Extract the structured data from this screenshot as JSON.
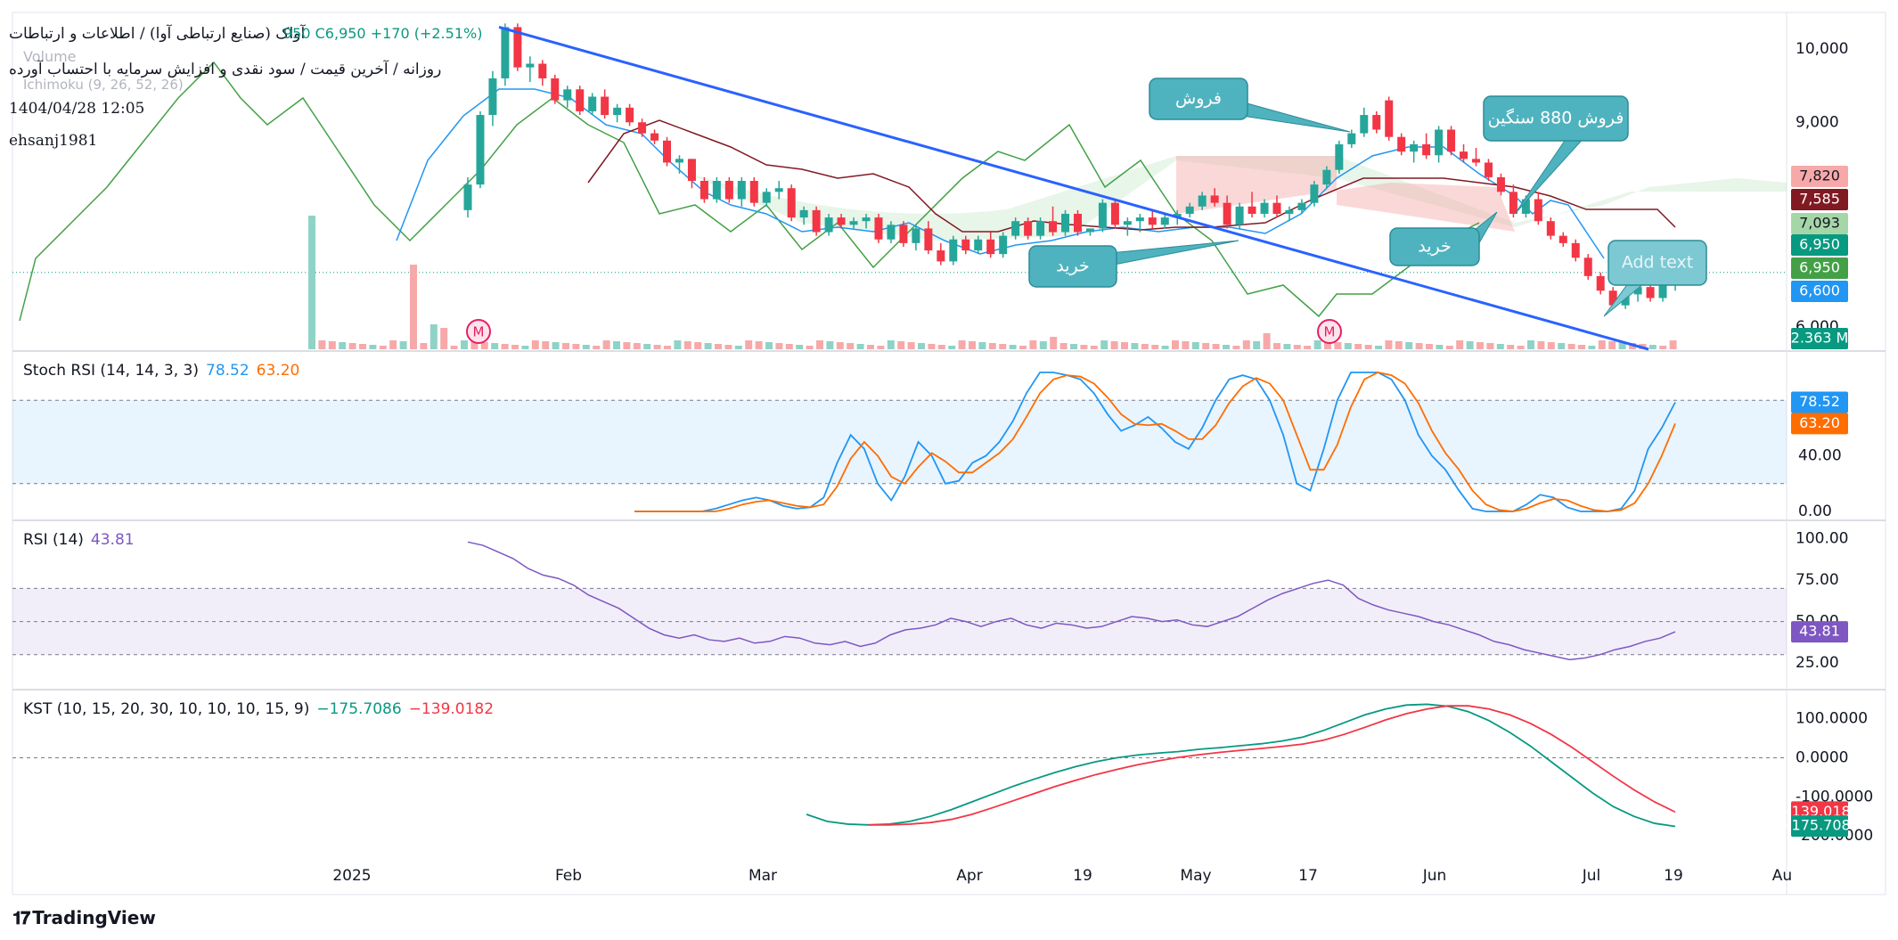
{
  "header": {
    "title": "آواک (صنایع ارتباطی آوا) / اطلاعات و ارتباطات",
    "ohlc": "950  C6,950  +170 (+2.51%)",
    "volume_label": "Volume",
    "ichimoku_label": "Ichimoku (9, 26, 52, 26)",
    "subtitle": "روزانه / آخرین قیمت / سود نقدی و افزایش سرمایه با احتساب آورده",
    "datetime": "1404/04/28 12:05",
    "author": "ehsanj1981"
  },
  "branding": {
    "logo_text": "TradingView"
  },
  "colors": {
    "up": "#26a69a",
    "down": "#f23645",
    "tenkan": "#2196f3",
    "kijun": "#801922",
    "chikou": "#43a047",
    "trend": "#2962ff",
    "stoch_k": "#2196f3",
    "stoch_d": "#ff6d00",
    "rsi": "#7e57c2",
    "kst": "#089981",
    "kst_signal": "#f23645",
    "callout": "#4fb3bf"
  },
  "chart_data": [
    {
      "type": "candlestick",
      "pane": "price",
      "ylim": [
        5900,
        10500
      ],
      "y_ticks": [
        10000,
        9000
      ],
      "x_ticks": [
        "2025",
        "Feb",
        "Mar",
        "Apr",
        "19",
        "May",
        "17",
        "Jun",
        "Jul",
        "19",
        "Au"
      ],
      "price_labels": [
        {
          "value": "7,820",
          "color": "#f7a9a9",
          "text": "#131722"
        },
        {
          "value": "7,585",
          "color": "#801922",
          "text": "#ffffff"
        },
        {
          "value": "7,093",
          "color": "#a5d6a7",
          "text": "#131722"
        },
        {
          "value": "6,950",
          "color": "#089981",
          "text": "#ffffff"
        },
        {
          "value": "6,950",
          "color": "#43a047",
          "text": "#ffffff"
        },
        {
          "value": "6,600",
          "color": "#2196f3",
          "text": "#ffffff"
        },
        {
          "value": "2.363 M",
          "color": "#089981",
          "text": "#ffffff"
        }
      ],
      "candles": [
        [
          7800,
          8250,
          7700,
          8150
        ],
        [
          8150,
          9150,
          8100,
          9100
        ],
        [
          9100,
          9700,
          8950,
          9600
        ],
        [
          9600,
          10350,
          9500,
          10300
        ],
        [
          10300,
          10350,
          9700,
          9750
        ],
        [
          9750,
          9900,
          9550,
          9800
        ],
        [
          9800,
          9850,
          9500,
          9600
        ],
        [
          9600,
          9650,
          9250,
          9300
        ],
        [
          9300,
          9500,
          9200,
          9450
        ],
        [
          9450,
          9500,
          9100,
          9150
        ],
        [
          9150,
          9400,
          9100,
          9350
        ],
        [
          9350,
          9450,
          9050,
          9100
        ],
        [
          9100,
          9250,
          9000,
          9200
        ],
        [
          9200,
          9250,
          8950,
          9000
        ],
        [
          9000,
          9050,
          8800,
          8850
        ],
        [
          8850,
          8900,
          8700,
          8750
        ],
        [
          8750,
          8800,
          8400,
          8450
        ],
        [
          8450,
          8550,
          8300,
          8500
        ],
        [
          8500,
          8500,
          8100,
          8200
        ],
        [
          8200,
          8250,
          7900,
          7950
        ],
        [
          7950,
          8250,
          7900,
          8200
        ],
        [
          8200,
          8250,
          7900,
          7950
        ],
        [
          7950,
          8250,
          7850,
          8200
        ],
        [
          8200,
          8250,
          7850,
          7900
        ],
        [
          7900,
          8100,
          7850,
          8050
        ],
        [
          8050,
          8200,
          7950,
          8100
        ],
        [
          8100,
          8150,
          7650,
          7700
        ],
        [
          7700,
          7850,
          7600,
          7800
        ],
        [
          7800,
          7850,
          7450,
          7500
        ],
        [
          7500,
          7750,
          7450,
          7700
        ],
        [
          7700,
          7750,
          7550,
          7600
        ],
        [
          7600,
          7700,
          7550,
          7650
        ],
        [
          7650,
          7750,
          7550,
          7700
        ],
        [
          7700,
          7750,
          7350,
          7400
        ],
        [
          7400,
          7650,
          7350,
          7600
        ],
        [
          7600,
          7650,
          7300,
          7350
        ],
        [
          7350,
          7600,
          7250,
          7550
        ],
        [
          7550,
          7650,
          7200,
          7250
        ],
        [
          7250,
          7350,
          7050,
          7100
        ],
        [
          7100,
          7450,
          7050,
          7400
        ],
        [
          7400,
          7450,
          7200,
          7250
        ],
        [
          7250,
          7450,
          7200,
          7400
        ],
        [
          7400,
          7500,
          7150,
          7200
        ],
        [
          7200,
          7500,
          7150,
          7450
        ],
        [
          7450,
          7700,
          7400,
          7650
        ],
        [
          7650,
          7700,
          7400,
          7450
        ],
        [
          7450,
          7700,
          7400,
          7650
        ],
        [
          7650,
          7850,
          7450,
          7500
        ],
        [
          7500,
          7800,
          7450,
          7750
        ],
        [
          7750,
          7800,
          7450,
          7500
        ],
        [
          7500,
          7550,
          7450,
          7550
        ],
        [
          7550,
          7950,
          7500,
          7900
        ],
        [
          7900,
          7950,
          7550,
          7600
        ],
        [
          7600,
          7700,
          7450,
          7650
        ],
        [
          7650,
          7750,
          7500,
          7700
        ],
        [
          7700,
          7800,
          7550,
          7600
        ],
        [
          7600,
          7750,
          7550,
          7700
        ],
        [
          7700,
          7800,
          7600,
          7750
        ],
        [
          7750,
          7900,
          7700,
          7850
        ],
        [
          7850,
          8050,
          7800,
          8000
        ],
        [
          8000,
          8100,
          7850,
          7900
        ],
        [
          7900,
          8000,
          7550,
          7600
        ],
        [
          7600,
          7900,
          7550,
          7850
        ],
        [
          7850,
          8050,
          7700,
          7750
        ],
        [
          7750,
          7950,
          7700,
          7900
        ],
        [
          7900,
          8000,
          7700,
          7750
        ],
        [
          7750,
          7850,
          7650,
          7800
        ],
        [
          7800,
          7950,
          7750,
          7900
        ],
        [
          7900,
          8200,
          7850,
          8150
        ],
        [
          8150,
          8400,
          8100,
          8350
        ],
        [
          8350,
          8750,
          8300,
          8700
        ],
        [
          8700,
          8900,
          8650,
          8850
        ],
        [
          8850,
          9200,
          8800,
          9100
        ],
        [
          9100,
          9150,
          8850,
          8900
        ],
        [
          9300,
          9350,
          8750,
          8800
        ],
        [
          8800,
          8850,
          8550,
          8600
        ],
        [
          8600,
          8750,
          8450,
          8700
        ],
        [
          8700,
          8850,
          8500,
          8550
        ],
        [
          8550,
          8950,
          8450,
          8900
        ],
        [
          8900,
          8950,
          8550,
          8600
        ],
        [
          8600,
          8700,
          8450,
          8500
        ],
        [
          8500,
          8650,
          8400,
          8450
        ],
        [
          8450,
          8500,
          8200,
          8250
        ],
        [
          8250,
          8300,
          8000,
          8050
        ],
        [
          8050,
          8150,
          7700,
          7750
        ],
        [
          7750,
          8000,
          7700,
          7950
        ],
        [
          7950,
          8050,
          7600,
          7650
        ],
        [
          7650,
          7700,
          7400,
          7450
        ],
        [
          7450,
          7500,
          7300,
          7350
        ],
        [
          7350,
          7400,
          7100,
          7150
        ],
        [
          7150,
          7200,
          6850,
          6900
        ],
        [
          6900,
          6950,
          6650,
          6700
        ],
        [
          6700,
          6750,
          6450,
          6500
        ],
        [
          6500,
          6700,
          6450,
          6650
        ],
        [
          6650,
          6800,
          6550,
          6750
        ],
        [
          6750,
          6800,
          6550,
          6600
        ],
        [
          6600,
          6800,
          6550,
          6780
        ],
        [
          6780,
          6900,
          6700,
          6950
        ]
      ],
      "trend_line": {
        "from": [
          "2025-01-25",
          10300
        ],
        "to": [
          "2025-07-12",
          5900
        ]
      },
      "annotations": [
        {
          "text": "فروش",
          "kind": "callout"
        },
        {
          "text": "فروش 880 سنگین",
          "kind": "callout"
        },
        {
          "text": "خرید",
          "kind": "callout"
        },
        {
          "text": "خرید",
          "kind": "callout"
        },
        {
          "text": "Add text",
          "kind": "callout-faded"
        }
      ],
      "markers": [
        "M",
        "M"
      ]
    },
    {
      "type": "line",
      "pane": "stoch_rsi",
      "title": "Stoch RSI (14, 14, 3, 3)",
      "values_label": [
        "78.52",
        "63.20"
      ],
      "ylim": [
        0,
        100
      ],
      "y_ticks": [
        "40.00",
        "0.00"
      ],
      "bands": [
        20,
        80
      ],
      "series": [
        {
          "name": "K",
          "values": [
            0,
            0,
            0,
            0,
            0,
            0,
            2,
            5,
            8,
            10,
            8,
            4,
            2,
            3,
            10,
            35,
            55,
            45,
            20,
            8,
            25,
            50,
            40,
            20,
            22,
            35,
            40,
            50,
            65,
            85,
            100,
            100,
            98,
            95,
            85,
            70,
            58,
            62,
            68,
            60,
            50,
            45,
            60,
            80,
            95,
            98,
            95,
            80,
            55,
            20,
            15,
            45,
            80,
            100,
            100,
            100,
            95,
            80,
            55,
            40,
            30,
            15,
            2,
            0,
            0,
            0,
            5,
            12,
            10,
            3,
            0,
            0,
            0,
            2,
            15,
            45,
            60,
            78.52
          ]
        },
        {
          "name": "D",
          "values": [
            0,
            0,
            0,
            0,
            0,
            0,
            0,
            2,
            5,
            7,
            8,
            6,
            4,
            3,
            5,
            18,
            38,
            50,
            40,
            25,
            20,
            32,
            42,
            36,
            28,
            28,
            35,
            42,
            52,
            68,
            85,
            95,
            98,
            97,
            92,
            82,
            70,
            63,
            62,
            63,
            58,
            52,
            52,
            62,
            78,
            90,
            96,
            92,
            80,
            55,
            30,
            30,
            48,
            75,
            95,
            100,
            98,
            92,
            78,
            58,
            42,
            30,
            15,
            5,
            1,
            0,
            2,
            6,
            9,
            8,
            4,
            1,
            0,
            1,
            6,
            20,
            40,
            63.2
          ]
        }
      ]
    },
    {
      "type": "line",
      "pane": "rsi",
      "title": "RSI (14)",
      "values_label": [
        "43.81"
      ],
      "ylim": [
        10,
        110
      ],
      "y_ticks": [
        "100.00",
        "75.00",
        "50.00",
        "25.00"
      ],
      "bands": [
        30,
        50,
        70
      ],
      "series": [
        {
          "name": "RSI",
          "values": [
            98,
            96,
            92,
            88,
            82,
            78,
            76,
            72,
            66,
            62,
            58,
            52,
            46,
            42,
            40,
            42,
            39,
            38,
            40,
            37,
            38,
            41,
            40,
            37,
            36,
            38,
            35,
            37,
            42,
            45,
            46,
            48,
            52,
            50,
            47,
            50,
            52,
            48,
            46,
            49,
            48,
            46,
            47,
            50,
            53,
            52,
            50,
            51,
            48,
            47,
            50,
            53,
            58,
            63,
            67,
            70,
            73,
            75,
            72,
            64,
            60,
            57,
            55,
            53,
            50,
            48,
            45,
            42,
            38,
            36,
            33,
            31,
            29,
            27,
            28,
            30,
            33,
            35,
            38,
            40,
            43.81
          ]
        }
      ]
    },
    {
      "type": "line",
      "pane": "kst",
      "title": "KST (10, 15, 20, 30, 10, 10, 10, 15, 9)",
      "values_label": [
        "−175.7086",
        "−139.0182"
      ],
      "ylim": [
        -250,
        170
      ],
      "y_ticks": [
        "100.0000",
        "0.0000",
        "-100.0000",
        "-200.0000"
      ],
      "series": [
        {
          "name": "KST",
          "values": [
            -145,
            -163,
            -170,
            -172,
            -170,
            -163,
            -150,
            -133,
            -113,
            -93,
            -73,
            -55,
            -38,
            -23,
            -10,
            0,
            7,
            12,
            16,
            22,
            26,
            31,
            36,
            43,
            53,
            70,
            90,
            110,
            125,
            135,
            137,
            132,
            118,
            95,
            65,
            30,
            -10,
            -50,
            -90,
            -125,
            -150,
            -168,
            -175.7086
          ]
        },
        {
          "name": "Signal",
          "values": [
            null,
            null,
            null,
            -172,
            -172,
            -170,
            -166,
            -158,
            -145,
            -128,
            -110,
            -92,
            -74,
            -58,
            -43,
            -30,
            -18,
            -8,
            1,
            8,
            14,
            19,
            24,
            29,
            35,
            45,
            60,
            78,
            97,
            113,
            125,
            133,
            133,
            125,
            110,
            88,
            60,
            27,
            -10,
            -47,
            -82,
            -113,
            -139.0182
          ]
        }
      ]
    }
  ]
}
